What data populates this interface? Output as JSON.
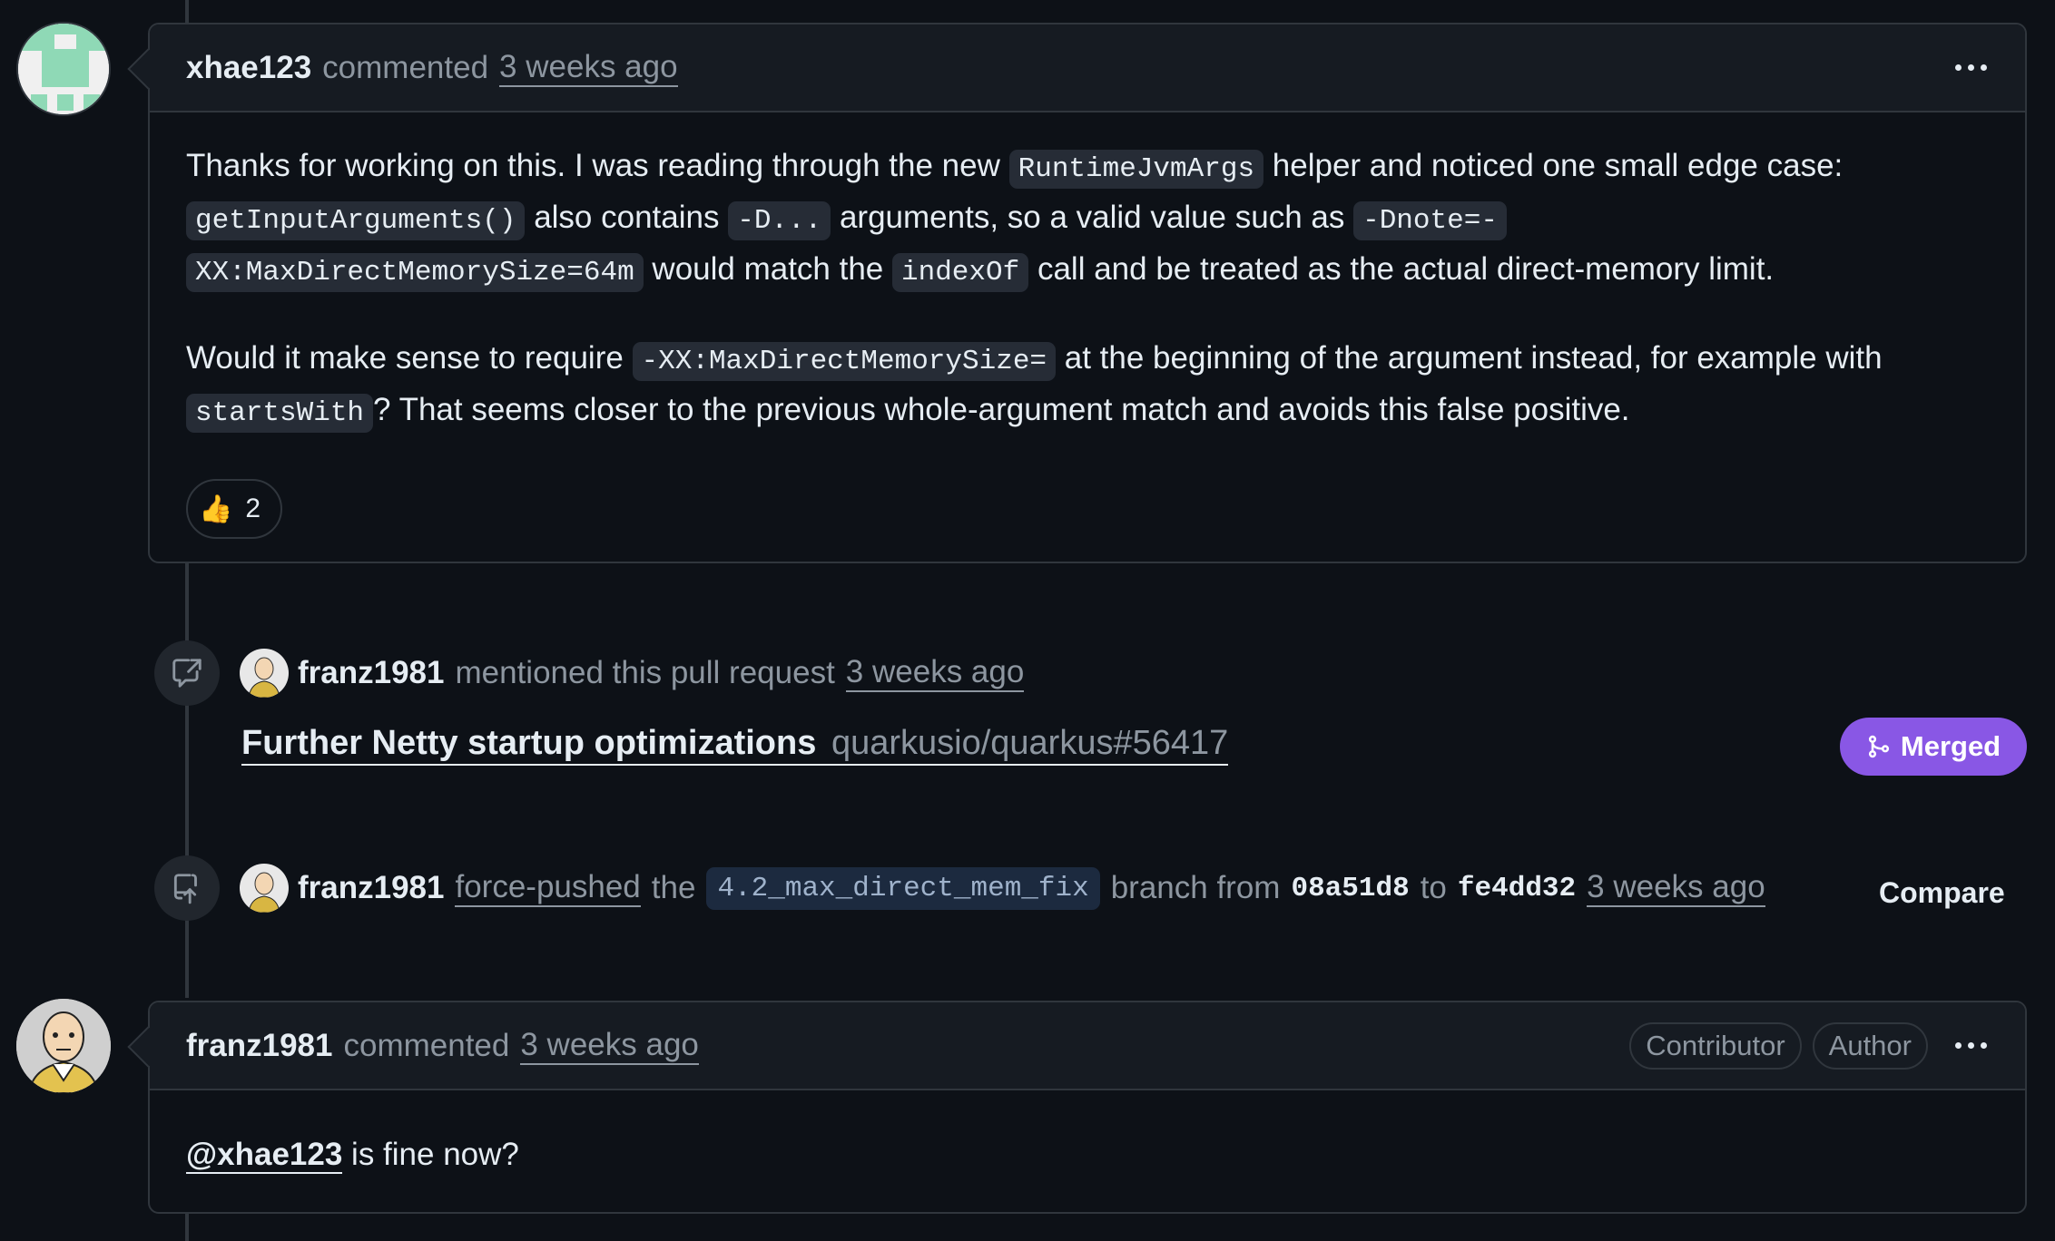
{
  "comment1": {
    "author": "xhae123",
    "action": "commented",
    "time": "3 weeks ago",
    "p1": {
      "t1": "Thanks for working on this. I was reading through the new ",
      "c1": "RuntimeJvmArgs",
      "t2": " helper and noticed one small edge case: ",
      "c2": "getInputArguments()",
      "t3": " also contains ",
      "c3": "-D...",
      "t4": " arguments, so a valid value such as ",
      "c4a": "-Dnote=-",
      "c4b": "XX:MaxDirectMemorySize=64m",
      "t5": " would match the ",
      "c5": "indexOf",
      "t6": " call and be treated as the actual direct-memory limit."
    },
    "p2": {
      "t1": "Would it make sense to require ",
      "c1": "-XX:MaxDirectMemorySize=",
      "t2": " at the beginning of the argument instead, for example with ",
      "c2": "startsWith",
      "t3": "? That seems closer to the previous whole-argument match and avoids this false positive."
    },
    "reaction": {
      "emoji": "👍",
      "count": "2"
    }
  },
  "event_mention": {
    "user": "franz1981",
    "action": "mentioned this pull request",
    "time": "3 weeks ago",
    "pr_title": "Further Netty startup optimizations",
    "pr_ref": "quarkusio/quarkus#56417",
    "status": "Merged"
  },
  "event_push": {
    "user": "franz1981",
    "action": "force-pushed",
    "the": "the",
    "branch": "4.2_max_direct_mem_fix",
    "branch_from": "branch from",
    "from_sha": "08a51d8",
    "to": "to",
    "to_sha": "fe4dd32",
    "time": "3 weeks ago",
    "compare": "Compare"
  },
  "comment2": {
    "author": "franz1981",
    "action": "commented",
    "time": "3 weeks ago",
    "badges": [
      "Contributor",
      "Author"
    ],
    "mention": "@xhae123",
    "text": " is fine now?"
  },
  "colors": {
    "background": "#0d1117",
    "header": "#161b22",
    "border": "#30363d",
    "merged": "#8957e5"
  },
  "icons": [
    "kebab-menu-icon",
    "thumbs-up-icon",
    "cross-reference-icon",
    "repo-push-icon",
    "git-merge-icon"
  ]
}
